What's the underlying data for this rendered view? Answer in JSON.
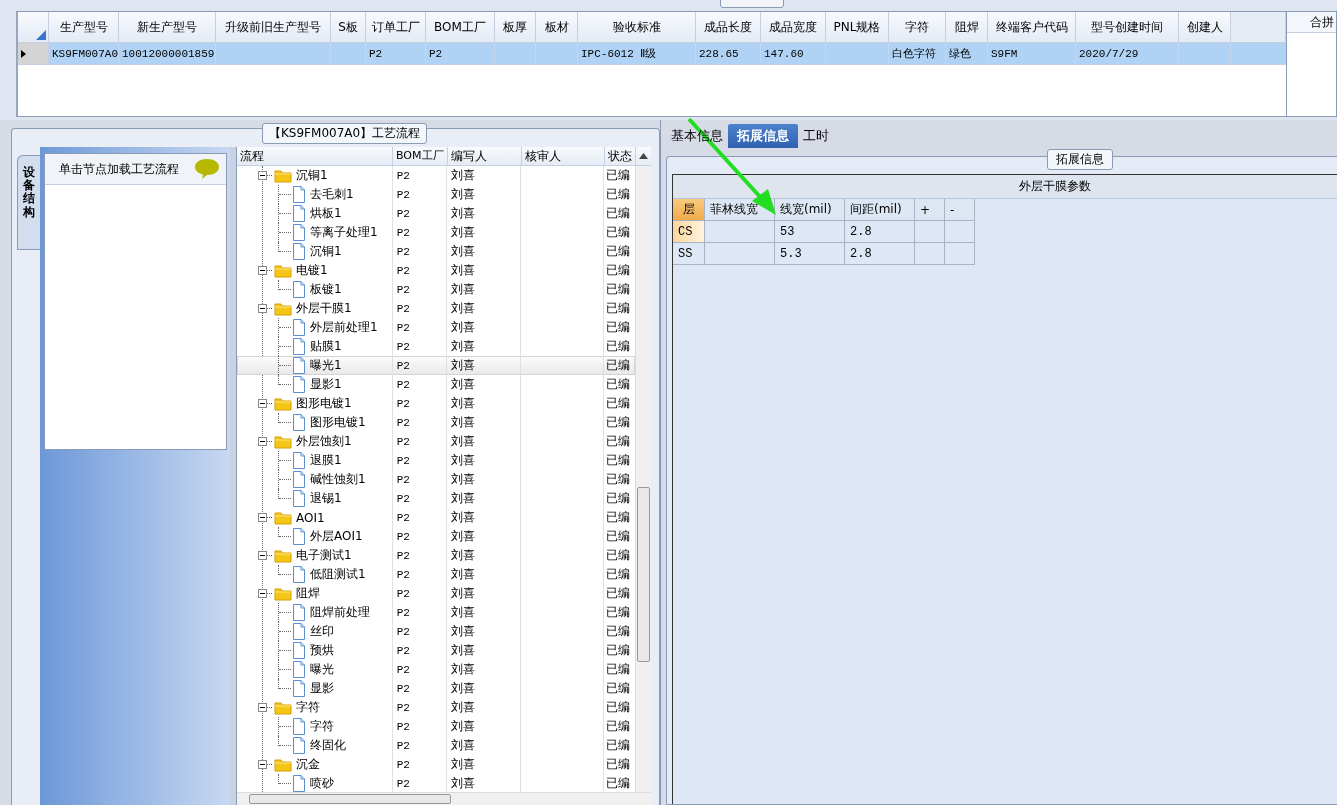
{
  "product_grid": {
    "columns": [
      "生产型号",
      "新生产型号",
      "升级前旧生产型号",
      "S板",
      "订单工厂",
      "BOM工厂",
      "板厚",
      "板材",
      "验收标准",
      "成品长度",
      "成品宽度",
      "PNL规格",
      "字符",
      "阻焊",
      "终端客户代码",
      "型号创建时间",
      "创建人"
    ],
    "rows": [
      {
        "selected": true,
        "cells": [
          "KS9FM007A0",
          "10012000001859",
          "",
          "",
          "P2",
          "P2",
          "",
          "",
          "IPC-6012 Ⅱ级",
          "228.65",
          "147.60",
          "",
          "白色字符",
          "绿色",
          "S9FM",
          "2020/7/29",
          ""
        ]
      }
    ]
  },
  "side_panel": {
    "header": "合拼"
  },
  "process_group": {
    "title": "【KS9FM007A0】工艺流程",
    "side_tab": "设备结构",
    "hint": "单击节点加载工艺流程",
    "tree": {
      "columns": [
        "流程",
        "BOM工厂",
        "编写人",
        "核审人",
        "状态"
      ],
      "nodes": [
        {
          "label": "沉铜1",
          "bom": "P2",
          "author": "刘喜",
          "status": "已编",
          "selected": false,
          "expanded": true,
          "children": [
            {
              "label": "去毛刺1",
              "bom": "P2",
              "author": "刘喜",
              "status": "已编",
              "selected": false
            },
            {
              "label": "烘板1",
              "bom": "P2",
              "author": "刘喜",
              "status": "已编",
              "selected": false
            },
            {
              "label": "等离子处理1",
              "bom": "P2",
              "author": "刘喜",
              "status": "已编",
              "selected": false
            },
            {
              "label": "沉铜1",
              "bom": "P2",
              "author": "刘喜",
              "status": "已编",
              "selected": false
            }
          ]
        },
        {
          "label": "电镀1",
          "bom": "P2",
          "author": "刘喜",
          "status": "已编",
          "selected": false,
          "expanded": true,
          "children": [
            {
              "label": "板镀1",
              "bom": "P2",
              "author": "刘喜",
              "status": "已编",
              "selected": false
            }
          ]
        },
        {
          "label": "外层干膜1",
          "bom": "P2",
          "author": "刘喜",
          "status": "已编",
          "selected": false,
          "expanded": true,
          "children": [
            {
              "label": "外层前处理1",
              "bom": "P2",
              "author": "刘喜",
              "status": "已编",
              "selected": false
            },
            {
              "label": "贴膜1",
              "bom": "P2",
              "author": "刘喜",
              "status": "已编",
              "selected": false
            },
            {
              "label": "曝光1",
              "bom": "P2",
              "author": "刘喜",
              "status": "已编",
              "selected": true
            },
            {
              "label": "显影1",
              "bom": "P2",
              "author": "刘喜",
              "status": "已编",
              "selected": false
            }
          ]
        },
        {
          "label": "图形电镀1",
          "bom": "P2",
          "author": "刘喜",
          "status": "已编",
          "selected": false,
          "expanded": true,
          "children": [
            {
              "label": "图形电镀1",
              "bom": "P2",
              "author": "刘喜",
              "status": "已编",
              "selected": false
            }
          ]
        },
        {
          "label": "外层蚀刻1",
          "bom": "P2",
          "author": "刘喜",
          "status": "已编",
          "selected": false,
          "expanded": true,
          "children": [
            {
              "label": "退膜1",
              "bom": "P2",
              "author": "刘喜",
              "status": "已编",
              "selected": false
            },
            {
              "label": "碱性蚀刻1",
              "bom": "P2",
              "author": "刘喜",
              "status": "已编",
              "selected": false
            },
            {
              "label": "退锡1",
              "bom": "P2",
              "author": "刘喜",
              "status": "已编",
              "selected": false
            }
          ]
        },
        {
          "label": "AOI1",
          "bom": "P2",
          "author": "刘喜",
          "status": "已编",
          "selected": false,
          "expanded": true,
          "children": [
            {
              "label": "外层AOI1",
              "bom": "P2",
              "author": "刘喜",
              "status": "已编",
              "selected": false
            }
          ]
        },
        {
          "label": "电子测试1",
          "bom": "P2",
          "author": "刘喜",
          "status": "已编",
          "selected": false,
          "expanded": true,
          "children": [
            {
              "label": "低阻测试1",
              "bom": "P2",
              "author": "刘喜",
              "status": "已编",
              "selected": false
            }
          ]
        },
        {
          "label": "阻焊",
          "bom": "P2",
          "author": "刘喜",
          "status": "已编",
          "selected": false,
          "expanded": true,
          "children": [
            {
              "label": "阻焊前处理",
              "bom": "P2",
              "author": "刘喜",
              "status": "已编",
              "selected": false
            },
            {
              "label": "丝印",
              "bom": "P2",
              "author": "刘喜",
              "status": "已编",
              "selected": false
            },
            {
              "label": "预烘",
              "bom": "P2",
              "author": "刘喜",
              "status": "已编",
              "selected": false
            },
            {
              "label": "曝光",
              "bom": "P2",
              "author": "刘喜",
              "status": "已编",
              "selected": false
            },
            {
              "label": "显影",
              "bom": "P2",
              "author": "刘喜",
              "status": "已编",
              "selected": false
            }
          ]
        },
        {
          "label": "字符",
          "bom": "P2",
          "author": "刘喜",
          "status": "已编",
          "selected": false,
          "expanded": true,
          "children": [
            {
              "label": "字符",
              "bom": "P2",
              "author": "刘喜",
              "status": "已编",
              "selected": false
            },
            {
              "label": "终固化",
              "bom": "P2",
              "author": "刘喜",
              "status": "已编",
              "selected": false
            }
          ]
        },
        {
          "label": "沉金",
          "bom": "P2",
          "author": "刘喜",
          "status": "已编",
          "selected": false,
          "expanded": true,
          "children": [
            {
              "label": "喷砂",
              "bom": "P2",
              "author": "刘喜",
              "status": "已编",
              "selected": false
            }
          ]
        }
      ]
    }
  },
  "detail_tabs": [
    {
      "label": "基本信息",
      "selected": false
    },
    {
      "label": "拓展信息",
      "selected": true
    },
    {
      "label": "工时",
      "selected": false
    }
  ],
  "extension": {
    "group_title": "拓展信息",
    "table_title": "外层干膜参数",
    "columns": [
      "层",
      "菲林线宽",
      "线宽(mil)",
      "间距(mil)",
      "+",
      "-"
    ],
    "rows": [
      {
        "selected": true,
        "cells": [
          "CS",
          "",
          "53",
          "2.8",
          "",
          ""
        ]
      },
      {
        "selected": false,
        "cells": [
          "SS",
          "",
          "5.3",
          "2.8",
          "",
          ""
        ]
      }
    ]
  }
}
